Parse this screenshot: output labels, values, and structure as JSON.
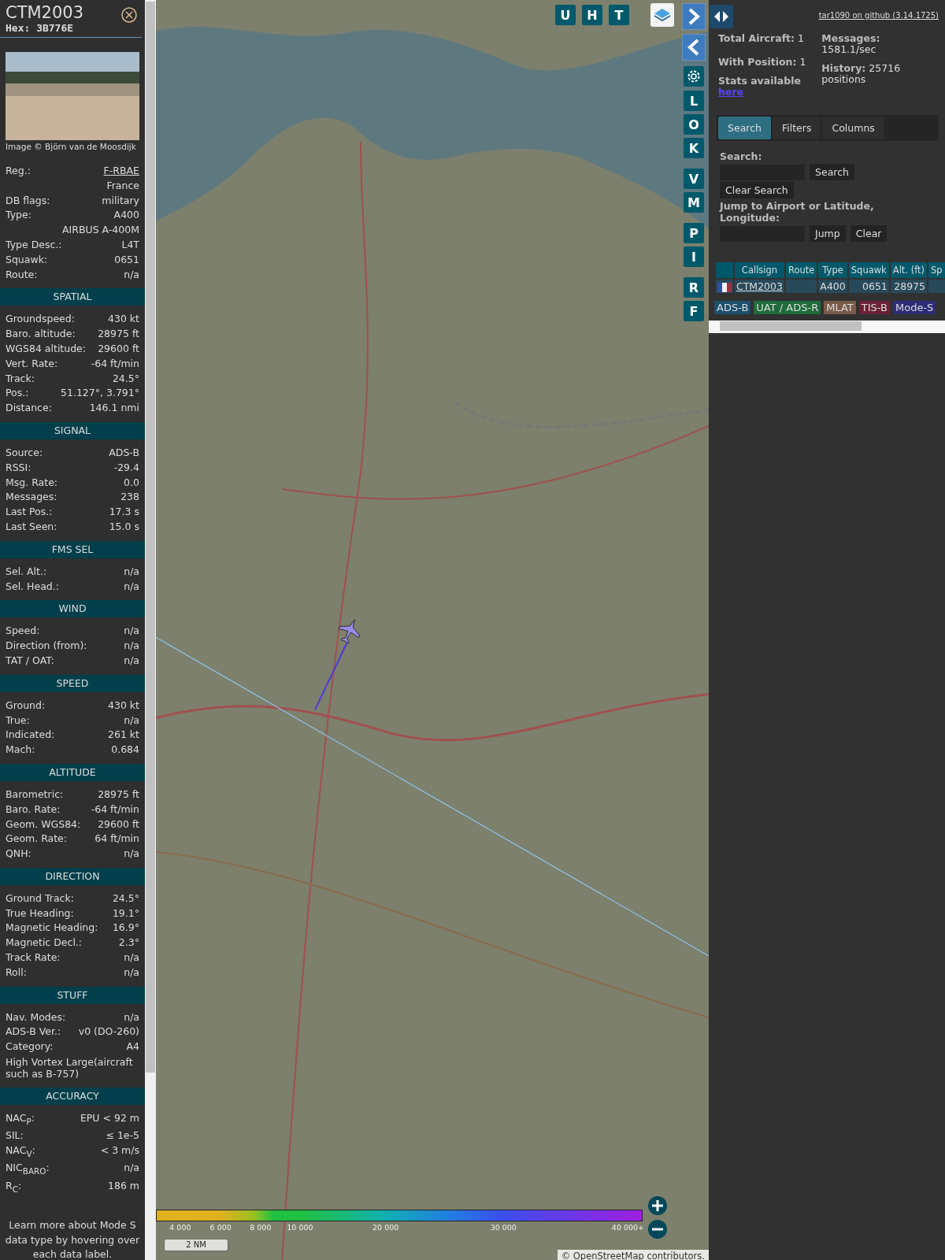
{
  "detail": {
    "callsign": "CTM2003",
    "hex_label": "Hex:",
    "hex": "3B776E",
    "photo_credit": "Image © Björn van de Moosdijk",
    "top_rows": [
      {
        "kind": "link",
        "label": "Reg.:",
        "value": "F-RBAE"
      },
      {
        "kind": "continuation",
        "value": "France"
      },
      {
        "kind": "pair",
        "label": "DB flags:",
        "value": "military"
      },
      {
        "kind": "pair",
        "label": "Type:",
        "value": "A400"
      },
      {
        "kind": "continuation",
        "value": "AIRBUS A-400M"
      },
      {
        "kind": "pair",
        "label": "Type Desc.:",
        "value": "L4T"
      },
      {
        "kind": "pair",
        "label": "Squawk:",
        "value": "0651"
      },
      {
        "kind": "pair",
        "label": "Route:",
        "value": "n/a"
      }
    ],
    "sections": [
      {
        "title": "SPATIAL",
        "rows": [
          {
            "kind": "pair",
            "label": "Groundspeed:",
            "value": "430 kt"
          },
          {
            "kind": "pair",
            "label": "Baro. altitude:",
            "value": "28975 ft"
          },
          {
            "kind": "pair",
            "label": "WGS84 altitude:",
            "value": "29600 ft"
          },
          {
            "kind": "pair",
            "label": "Vert. Rate:",
            "value": "-64 ft/min"
          },
          {
            "kind": "pair",
            "label": "Track:",
            "value": "24.5°"
          },
          {
            "kind": "pair",
            "label": "Pos.:",
            "value": "51.127°, 3.791°"
          },
          {
            "kind": "pair",
            "label": "Distance:",
            "value": "146.1 nmi"
          }
        ]
      },
      {
        "title": "SIGNAL",
        "rows": [
          {
            "kind": "pair",
            "label": "Source:",
            "value": "ADS-B"
          },
          {
            "kind": "pair",
            "label": "RSSI:",
            "value": "-29.4"
          },
          {
            "kind": "pair",
            "label": "Msg. Rate:",
            "value": "0.0"
          },
          {
            "kind": "pair",
            "label": "Messages:",
            "value": "238"
          },
          {
            "kind": "pair",
            "label": "Last Pos.:",
            "value": "17.3 s"
          },
          {
            "kind": "pair",
            "label": "Last Seen:",
            "value": "15.0 s"
          }
        ]
      },
      {
        "title": "FMS SEL",
        "rows": [
          {
            "kind": "pair",
            "label": "Sel. Alt.:",
            "value": "n/a"
          },
          {
            "kind": "pair",
            "label": "Sel. Head.:",
            "value": "n/a"
          }
        ]
      },
      {
        "title": "WIND",
        "rows": [
          {
            "kind": "pair",
            "label": "Speed:",
            "value": "n/a"
          },
          {
            "kind": "pair",
            "label": "Direction (from):",
            "value": "n/a"
          },
          {
            "kind": "pair",
            "label": "TAT / OAT:",
            "value": "n/a"
          }
        ]
      },
      {
        "title": "SPEED",
        "rows": [
          {
            "kind": "pair",
            "label": "Ground:",
            "value": "430 kt"
          },
          {
            "kind": "pair",
            "label": "True:",
            "value": "n/a"
          },
          {
            "kind": "pair",
            "label": "Indicated:",
            "value": "261 kt"
          },
          {
            "kind": "pair",
            "label": "Mach:",
            "value": "0.684"
          }
        ]
      },
      {
        "title": "ALTITUDE",
        "rows": [
          {
            "kind": "pair",
            "label": "Barometric:",
            "value": "28975 ft"
          },
          {
            "kind": "pair",
            "label": "Baro. Rate:",
            "value": "-64 ft/min"
          },
          {
            "kind": "pair",
            "label": "Geom. WGS84:",
            "value": "29600 ft"
          },
          {
            "kind": "pair",
            "label": "Geom. Rate:",
            "value": "64 ft/min"
          },
          {
            "kind": "pair",
            "label": "QNH:",
            "value": "n/a"
          }
        ]
      },
      {
        "title": "DIRECTION",
        "rows": [
          {
            "kind": "pair",
            "label": "Ground Track:",
            "value": "24.5°"
          },
          {
            "kind": "pair",
            "label": "True Heading:",
            "value": "19.1°"
          },
          {
            "kind": "pair",
            "label": "Magnetic Heading:",
            "value": "16.9°"
          },
          {
            "kind": "pair",
            "label": "Magnetic Decl.:",
            "value": "2.3°"
          },
          {
            "kind": "pair",
            "label": "Track Rate:",
            "value": "n/a"
          },
          {
            "kind": "pair",
            "label": "Roll:",
            "value": "n/a"
          }
        ]
      },
      {
        "title": "STUFF",
        "rows": [
          {
            "kind": "pair",
            "label": "Nav. Modes:",
            "value": "n/a"
          },
          {
            "kind": "pair",
            "label": "ADS-B Ver.:",
            "value": "v0 (DO-260)"
          },
          {
            "kind": "pair",
            "label": "Category:",
            "value": "A4"
          },
          {
            "kind": "note",
            "value": "High Vortex Large(aircraft such as B-757)"
          }
        ]
      },
      {
        "title": "ACCURACY",
        "rows": [
          {
            "kind": "pair",
            "label": "NAC$_{P}$:",
            "value": "EPU < 92 m"
          },
          {
            "kind": "pair",
            "label": "SIL:",
            "value": "≤ 1e-5"
          },
          {
            "kind": "pair",
            "label": "NAC$_{V}$:",
            "value": "< 3 m/s"
          },
          {
            "kind": "pair",
            "label": "NIC$_{BARO}$:",
            "value": "n/a"
          },
          {
            "kind": "pair",
            "label": "R$_{C}$:",
            "value": "186 m"
          }
        ]
      }
    ],
    "footnote": "Learn more about Mode S data type by hovering over each data label."
  },
  "map": {
    "toolbar_buttons": [
      "U",
      "H",
      "T"
    ],
    "side_button_groups": [
      [
        "L",
        "O",
        "K"
      ],
      [
        "V",
        "M"
      ],
      [
        "P",
        "I"
      ],
      [
        "R",
        "F"
      ]
    ],
    "legend_labels": [
      "4 000",
      "6 000",
      "8 000",
      "10 000",
      "20 000",
      "30 000",
      "40 000+"
    ],
    "scale": "2 NM",
    "attribution_prefix": "©",
    "attribution_link": "OpenStreetMap",
    "attribution_suffix": "contributors."
  },
  "panel": {
    "github_link": "tar1090 on github (3.14.1725)",
    "stats_left": [
      "**Total Aircraft:** 1",
      "**With Position:** 1"
    ],
    "stats_right": [
      "**Messages:** 1581.1/sec",
      "**History:** 25716 positions"
    ],
    "stats_note": "Stats available",
    "stats_link": "here",
    "tabs": [
      {
        "label": "Search",
        "selected": true
      },
      {
        "label": "Filters",
        "selected": false
      },
      {
        "label": "Columns",
        "selected": false
      }
    ],
    "search_label": "Search:",
    "search_button": "Search",
    "clear_search_button": "Clear Search",
    "jump_label": "Jump to Airport or Latitude, Longitude:",
    "jump_button": "Jump",
    "clear_button": "Clear",
    "table": {
      "columns": [
        "Callsign",
        "Route",
        "Type",
        "Squawk",
        "Alt. (ft)",
        "Sp"
      ],
      "rows": [
        {
          "callsign": "CTM2003",
          "type": "A400",
          "squawk": "0651",
          "altitude": "28975"
        }
      ]
    },
    "source_tags": [
      {
        "label": "ADS-B",
        "color": "#1c4f6b"
      },
      {
        "label": "UAT / ADS-R",
        "color": "#1f6b3a"
      },
      {
        "label": "MLAT",
        "color": "#7a5a48"
      },
      {
        "label": "TIS-B",
        "color": "#6b2236"
      },
      {
        "label": "Mode-S",
        "color": "#2c2c78"
      }
    ]
  }
}
